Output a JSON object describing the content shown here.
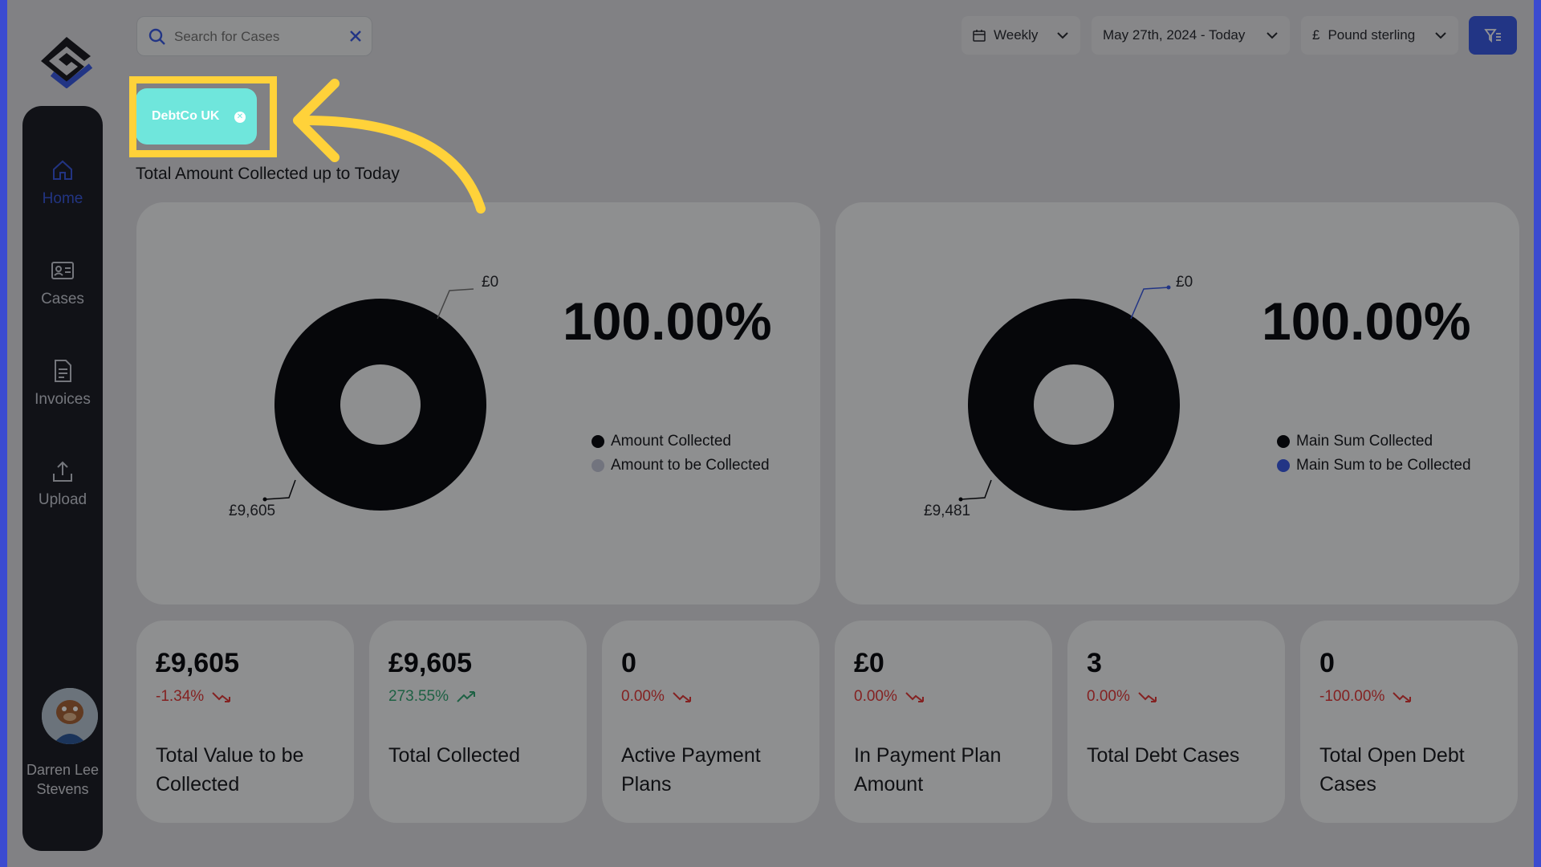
{
  "sidebar": {
    "items": [
      {
        "label": "Home",
        "icon": "home-icon",
        "active": true
      },
      {
        "label": "Cases",
        "icon": "id-card-icon"
      },
      {
        "label": "Invoices",
        "icon": "document-icon"
      },
      {
        "label": "Upload",
        "icon": "upload-icon"
      }
    ],
    "user": {
      "name": "Darren Lee Stevens"
    }
  },
  "search": {
    "placeholder": "Search for Cases"
  },
  "toolbar": {
    "period": "Weekly",
    "date_range": "May 27th, 2024 - Today",
    "currency_symbol": "£",
    "currency": "Pound sterling"
  },
  "filter_chip": {
    "label": "DebtCo UK"
  },
  "section_title": "Total Amount Collected up to Today",
  "charts": [
    {
      "percent": "100.00%",
      "label_top": "£0",
      "label_bottom": "£9,605",
      "legend": [
        "Amount Collected",
        "Amount to be Collected"
      ]
    },
    {
      "percent": "100.00%",
      "label_top": "£0",
      "label_bottom": "£9,481",
      "legend": [
        "Main Sum Collected",
        "Main Sum to be Collected"
      ]
    }
  ],
  "chart_data": [
    {
      "type": "pie",
      "categories": [
        "Amount Collected",
        "Amount to be Collected"
      ],
      "values": [
        9605,
        0
      ],
      "colors": [
        "#0c0d12",
        "#c5c8d9"
      ]
    },
    {
      "type": "pie",
      "categories": [
        "Main Sum Collected",
        "Main Sum to be Collected"
      ],
      "values": [
        9481,
        0
      ],
      "colors": [
        "#0c0d12",
        "#3c5ce6"
      ]
    }
  ],
  "stats": [
    {
      "value": "£9,605",
      "change": "-1.34%",
      "trend": "down",
      "name": "Total Value to be Collected"
    },
    {
      "value": "£9,605",
      "change": "273.55%",
      "trend": "up",
      "name": "Total Collected"
    },
    {
      "value": "0",
      "change": "0.00%",
      "trend": "down",
      "name": "Active Payment Plans"
    },
    {
      "value": "£0",
      "change": "0.00%",
      "trend": "down",
      "name": "In Payment Plan Amount"
    },
    {
      "value": "3",
      "change": "0.00%",
      "trend": "down",
      "name": "Total Debt Cases"
    },
    {
      "value": "0",
      "change": "-100.00%",
      "trend": "down",
      "name": "Total Open Debt Cases"
    }
  ],
  "colors": {
    "accent": "#3c5ce6",
    "chip": "#6fe6dc",
    "highlight": "#ffd23a",
    "negative": "#e33b3b",
    "positive": "#35a775"
  }
}
